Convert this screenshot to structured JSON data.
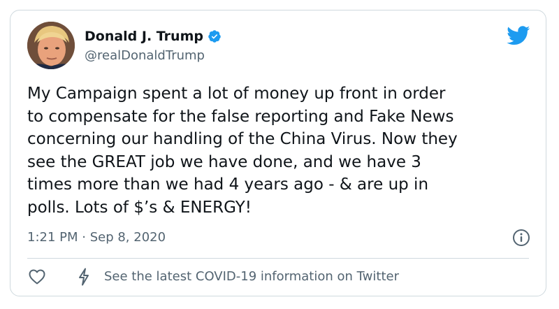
{
  "tweet": {
    "display_name": "Donald J. Trump",
    "handle": "@realDonaldTrump",
    "text": "My Campaign spent a lot of money up front in order\nto compensate for the false reporting and Fake News\nconcerning our handling of the China Virus. Now they\nsee the GREAT job we have done, and we have 3\ntimes more than we had 4 years ago - & are up in\npolls. Lots of $’s & ENERGY!",
    "timestamp": "1:21 PM · Sep 8, 2020",
    "verified": true
  },
  "footer": {
    "covid_link": "See the latest COVID-19 information on Twitter"
  },
  "icons": {
    "brand": "twitter-bird-icon",
    "verified": "verified-badge-icon",
    "info": "info-icon",
    "like": "heart-icon",
    "covid": "lightning-bolt-icon"
  },
  "colors": {
    "twitter_blue": "#1d9bf0",
    "text_primary": "#0f1419",
    "text_secondary": "#536471",
    "border": "#cfd9de"
  }
}
